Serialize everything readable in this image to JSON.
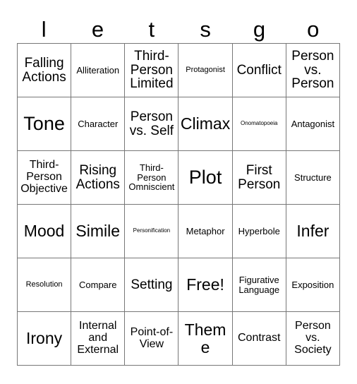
{
  "header": {
    "letters": [
      "l",
      "e",
      "t",
      "s",
      "g",
      "o"
    ]
  },
  "grid": {
    "columns": 6,
    "rows": 6,
    "cells": [
      {
        "text": "Falling Actions",
        "size": "lg"
      },
      {
        "text": "Alliteration",
        "size": "sm"
      },
      {
        "text": "Third-Person Limited",
        "size": "lg"
      },
      {
        "text": "Protagonist",
        "size": "xs"
      },
      {
        "text": "Conflict",
        "size": "lg"
      },
      {
        "text": "Person vs. Person",
        "size": "lg"
      },
      {
        "text": "Tone",
        "size": "xxl"
      },
      {
        "text": "Character",
        "size": "sm"
      },
      {
        "text": "Person vs. Self",
        "size": "lg"
      },
      {
        "text": "Climax",
        "size": "xl"
      },
      {
        "text": "Onomatopoeia",
        "size": "xxs"
      },
      {
        "text": "Antagonist",
        "size": "sm"
      },
      {
        "text": "Third-Person Objective",
        "size": "md"
      },
      {
        "text": "Rising Actions",
        "size": "lg"
      },
      {
        "text": "Third-Person Omniscient",
        "size": "sm"
      },
      {
        "text": "Plot",
        "size": "xxl"
      },
      {
        "text": "First Person",
        "size": "lg"
      },
      {
        "text": "Structure",
        "size": "sm"
      },
      {
        "text": "Mood",
        "size": "xl"
      },
      {
        "text": "Simile",
        "size": "xl"
      },
      {
        "text": "Personification",
        "size": "xxs"
      },
      {
        "text": "Metaphor",
        "size": "sm"
      },
      {
        "text": "Hyperbole",
        "size": "sm"
      },
      {
        "text": "Infer",
        "size": "xl"
      },
      {
        "text": "Resolution",
        "size": "xs"
      },
      {
        "text": "Compare",
        "size": "sm"
      },
      {
        "text": "Setting",
        "size": "lg"
      },
      {
        "text": "Free!",
        "size": "xl"
      },
      {
        "text": "Figurative Language",
        "size": "sm"
      },
      {
        "text": "Exposition",
        "size": "sm"
      },
      {
        "text": "Irony",
        "size": "xl"
      },
      {
        "text": "Internal and External",
        "size": "md"
      },
      {
        "text": "Point-of-View",
        "size": "md"
      },
      {
        "text": "Theme",
        "size": "xl"
      },
      {
        "text": "Contrast",
        "size": "md"
      },
      {
        "text": "Person vs. Society",
        "size": "md"
      }
    ]
  },
  "colors": {
    "border": "#777777",
    "text": "#000000",
    "background": "#ffffff"
  }
}
